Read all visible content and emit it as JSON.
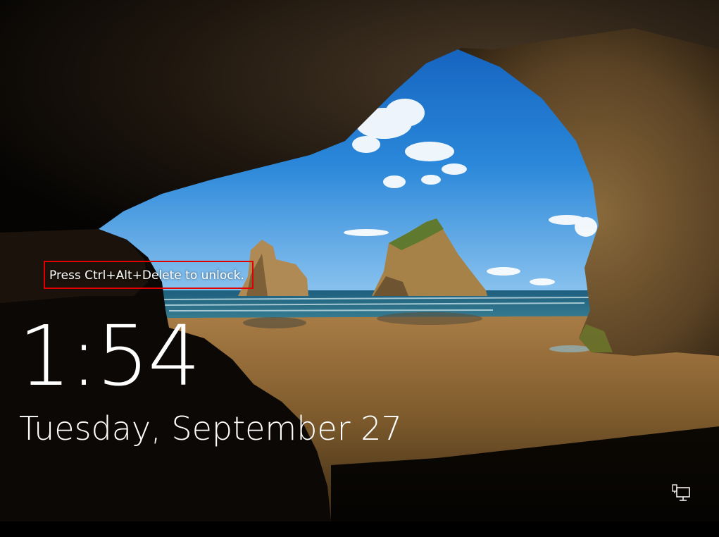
{
  "lockscreen": {
    "unlock_hint": "Press Ctrl+Alt+Delete to unlock.",
    "time": "1:54",
    "date": "Tuesday, September 27",
    "network_icon": "network-status-icon"
  },
  "colors": {
    "text": "#ffffff",
    "highlight_border": "#e00000",
    "background": "#000000"
  }
}
